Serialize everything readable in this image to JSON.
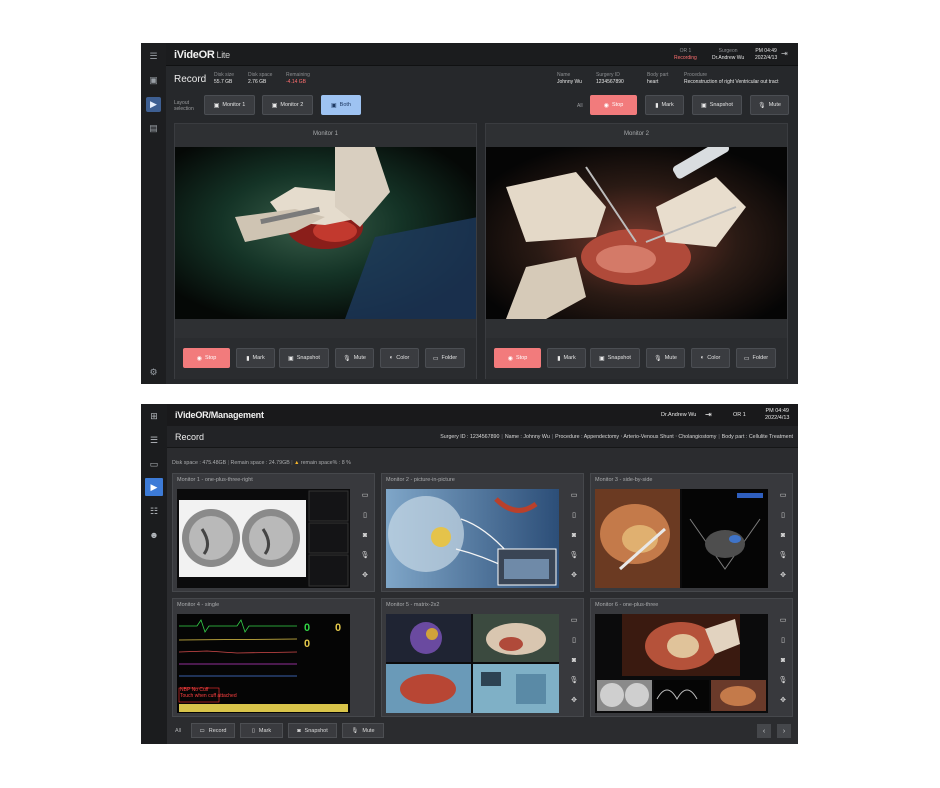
{
  "app1": {
    "brand": "iVideOR",
    "brand_sub": "Lite",
    "header": {
      "or_label": "OR 1",
      "or_status": "Recording",
      "surgeon_label": "Surgeon",
      "surgeon": "Dr.Andrew Wu",
      "time": "PM 04:49",
      "date": "2022/4/13"
    },
    "title": "Record",
    "disk": [
      {
        "label": "Disk size",
        "value": "55.7 GB",
        "alert": false
      },
      {
        "label": "Disk space",
        "value": "2.76 GB",
        "alert": false
      },
      {
        "label": "Remaining",
        "value": "-4.14 GB",
        "alert": true
      }
    ],
    "patient": [
      {
        "label": "Name",
        "value": "Johnny Wu"
      },
      {
        "label": "Surgery ID",
        "value": "1234567890"
      },
      {
        "label": "Body part",
        "value": "heart"
      },
      {
        "label": "Procedure",
        "value": "Reconstruction of right Ventricular out tract"
      }
    ],
    "layout_label": "Layout selection",
    "layout_buttons": [
      "Monitor 1",
      "Monitor 2",
      "Both"
    ],
    "layout_selected": "Both",
    "all_label": "All",
    "global_controls": [
      "Stop",
      "Mark",
      "Snapshot",
      "Mute"
    ],
    "monitors": [
      {
        "title": "Monitor 1",
        "controls": [
          "Stop",
          "Mark",
          "Snapshot",
          "Mute",
          "Color",
          "Folder"
        ]
      },
      {
        "title": "Monitor 2",
        "controls": [
          "Stop",
          "Mark",
          "Snapshot",
          "Mute",
          "Color",
          "Folder"
        ]
      }
    ]
  },
  "app2": {
    "brand": "iVideOR/Management",
    "user": "Dr.Andrew Wu",
    "or": "OR 1",
    "time": "PM 04:49",
    "date": "2022/4/13",
    "title": "Record",
    "info": [
      "Surgery ID : 1234567890",
      "Name : Johnny Wu",
      "Procedure : Appendectomy ‧ Arterio-Venous Shunt ‧ Cholangiostomy",
      "Body part : Cellulite Treatment"
    ],
    "disk_space": "Disk space : 475.48GB",
    "remain_space": "Remain space : 24.79GB",
    "remain_pct": "remain space% : 8 %",
    "monitors": [
      {
        "title": "Monitor 1 - one-plus-three-right"
      },
      {
        "title": "Monitor 2 - picture-in-picture"
      },
      {
        "title": "Monitor 3 - side-by-side"
      },
      {
        "title": "Monitor 4 - single"
      },
      {
        "title": "Monitor 5 - matrix-2x2"
      },
      {
        "title": "Monitor 6 - one-plus-three"
      }
    ],
    "all_label": "All",
    "bottom_controls": [
      "Record",
      "Mark",
      "Snapshot",
      "Mute"
    ],
    "vitals": {
      "big_values": [
        "0",
        "0",
        "0"
      ],
      "nbp": "NBP No Cuff",
      "nbp_sub": "Touch when cuff attached"
    }
  },
  "colors": {
    "accent_blue": "#3d7bd7",
    "stop_red": "#f27b7c",
    "selected_blue": "#9ec3f2"
  }
}
